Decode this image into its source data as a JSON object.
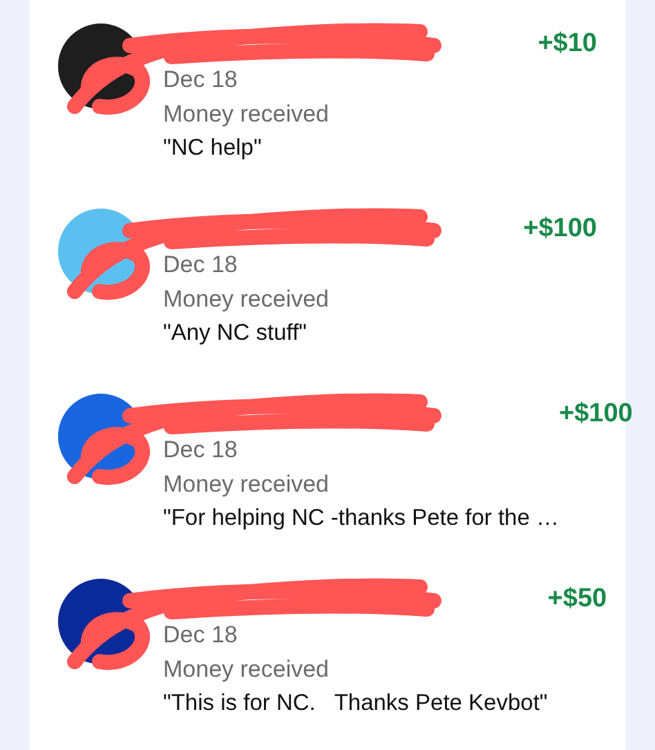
{
  "transactions": [
    {
      "color": "#1e1e1e",
      "redacted": true,
      "amount": "+$10",
      "date": "Dec 18",
      "status": "Money received",
      "note": "\"NC help\""
    },
    {
      "color": "#5bc0f0",
      "redacted": true,
      "amount": "+$100",
      "date": "Dec 18",
      "status": "Money received",
      "note": "\"Any NC stuff\""
    },
    {
      "color": "#1a66e0",
      "redacted": true,
      "amount": "+$100",
      "date": "Dec 18",
      "status": "Money received",
      "note": "\"For helping NC -thanks Pete for the …"
    },
    {
      "color": "#0a2a9a",
      "redacted": true,
      "amount": "+$50",
      "date": "Dec 18",
      "status": "Money received",
      "note": "\"This is for NC.   Thanks Pete Kevbot\""
    }
  ]
}
